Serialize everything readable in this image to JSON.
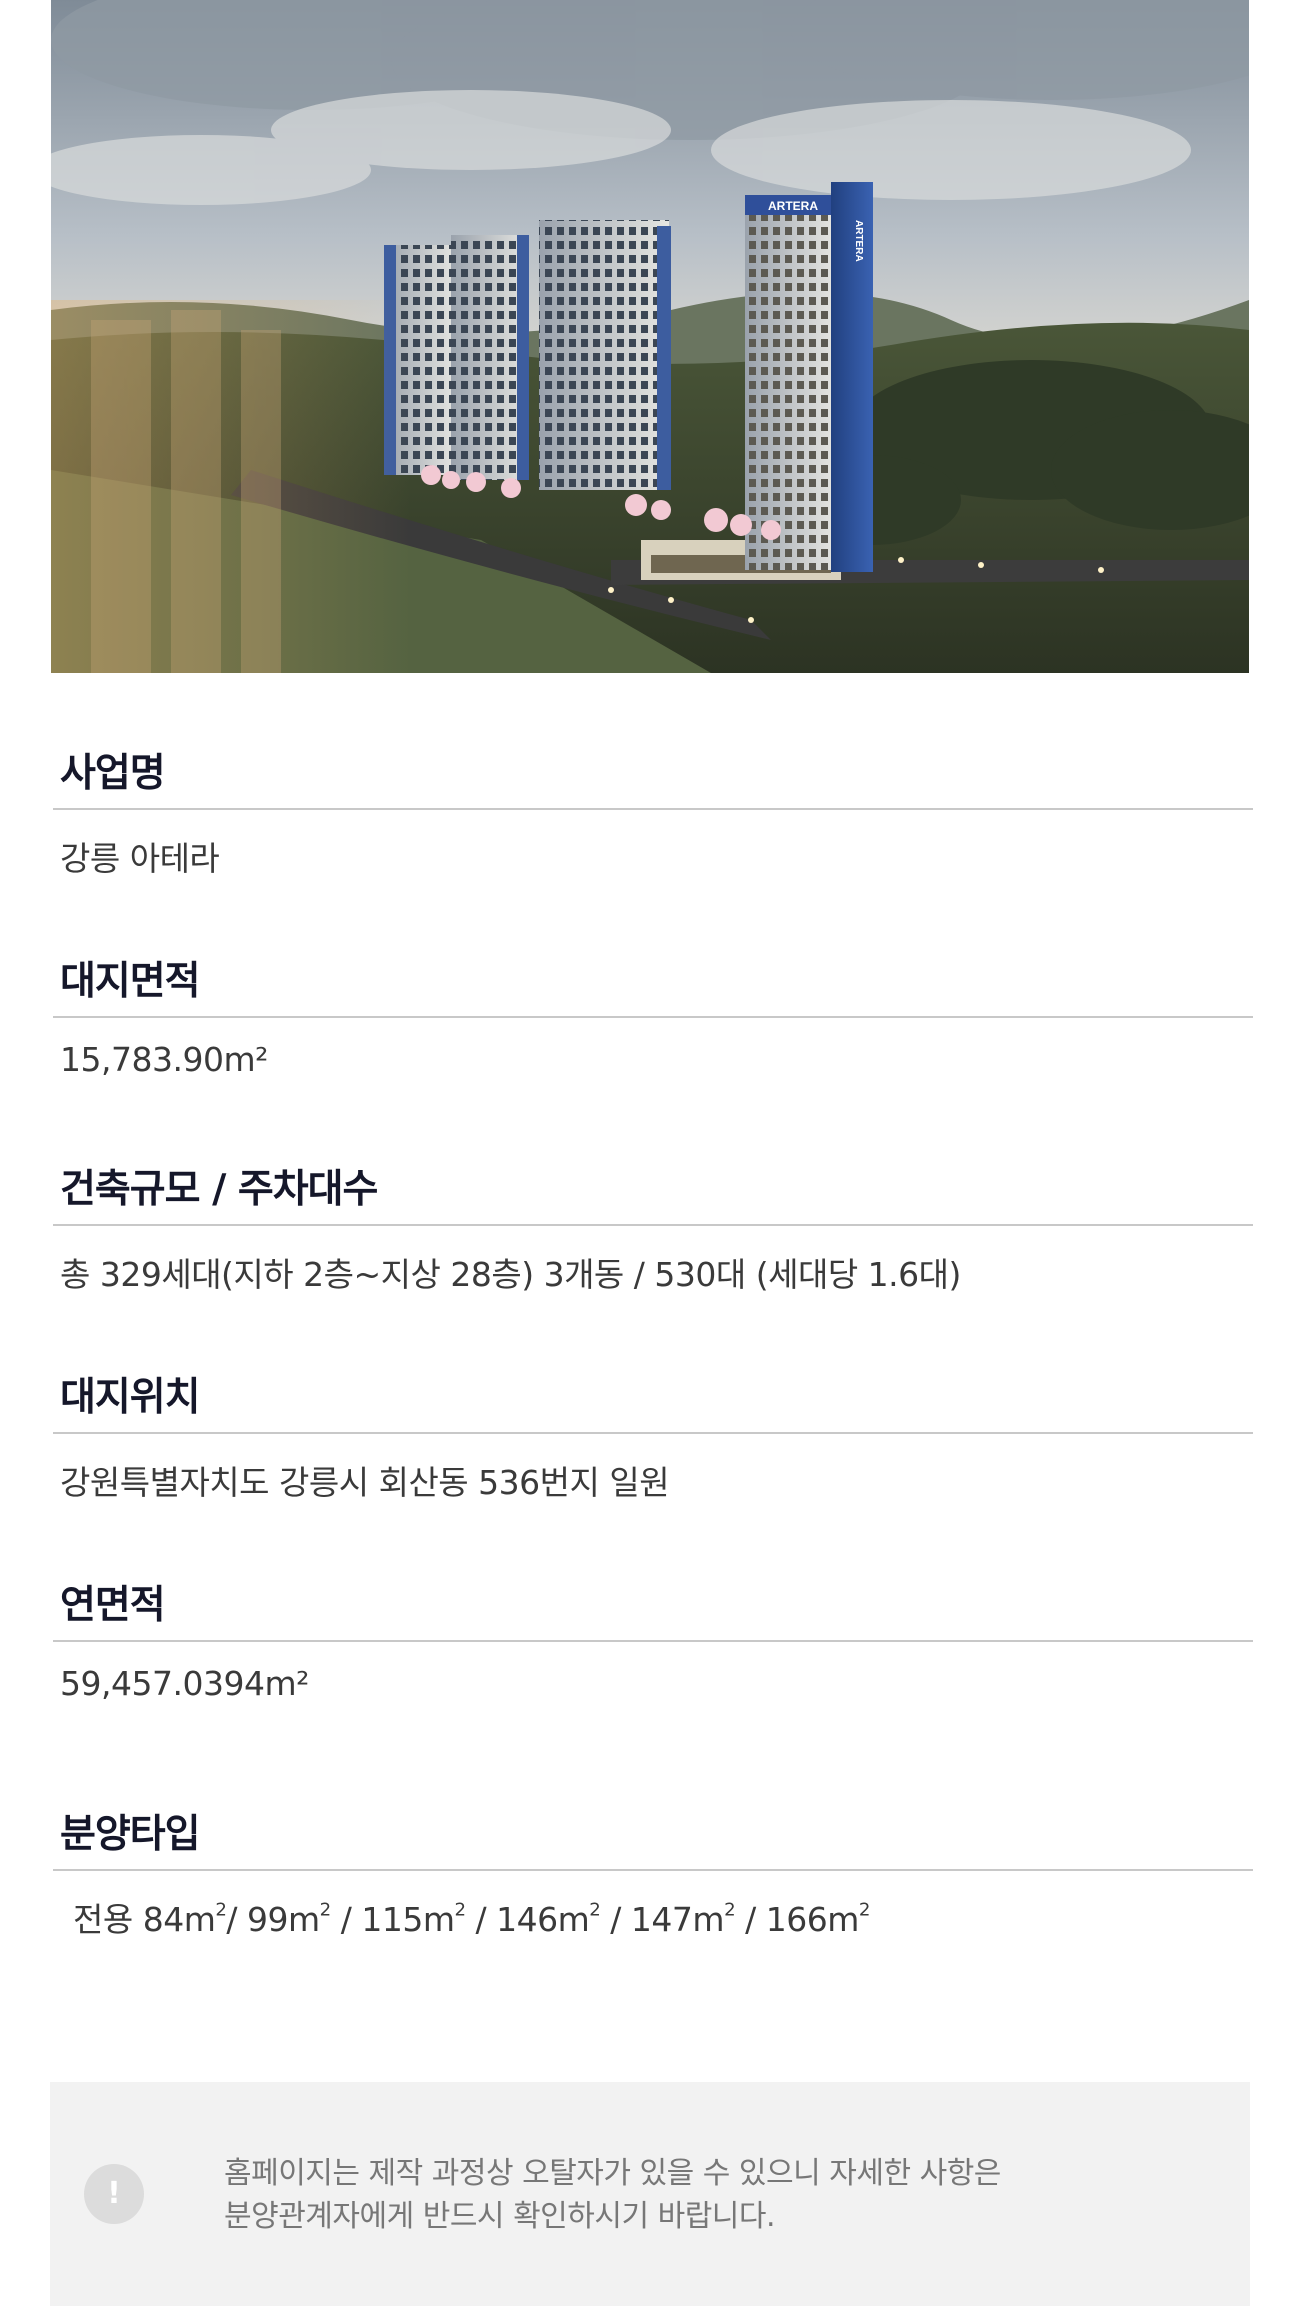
{
  "hero": {
    "image_name": "apartment-complex-rendering",
    "building_sign": "ARTERA",
    "building_vertical_sign": "ARTERA"
  },
  "info": [
    {
      "label": "사업명",
      "value": "강릉 아테라"
    },
    {
      "label": "대지면적",
      "value": "15,783.90m²"
    },
    {
      "label": "건축규모 / 주차대수",
      "value": "총 329세대(지하 2층~지상 28층) 3개동 / 530대 (세대당 1.6대)"
    },
    {
      "label": "대지위치",
      "value": "강원특별자치도 강릉시 회산동 536번지 일원"
    },
    {
      "label": "연면적",
      "value": "59,457.0394m²"
    },
    {
      "label": "분양타입",
      "value_prefix": "전용",
      "types": [
        "84m",
        "99m",
        "115m",
        "146m",
        "147m",
        "166m"
      ],
      "unit_sup": "2"
    }
  ],
  "notice": {
    "icon": "exclamation-icon",
    "icon_glyph": "!",
    "line1": "홈페이지는 제작 과정상 오탈자가 있을 수 있으니 자세한 사항은",
    "line2": "분양관계자에게 반드시 확인하시기 바랍니다."
  },
  "colors": {
    "label": "#15172a",
    "value": "#3a3a3a",
    "rule": "#c8c8c8",
    "notice_bg": "#f2f2f2",
    "notice_text": "#777777",
    "tower_accent": "#2f4f9a"
  }
}
